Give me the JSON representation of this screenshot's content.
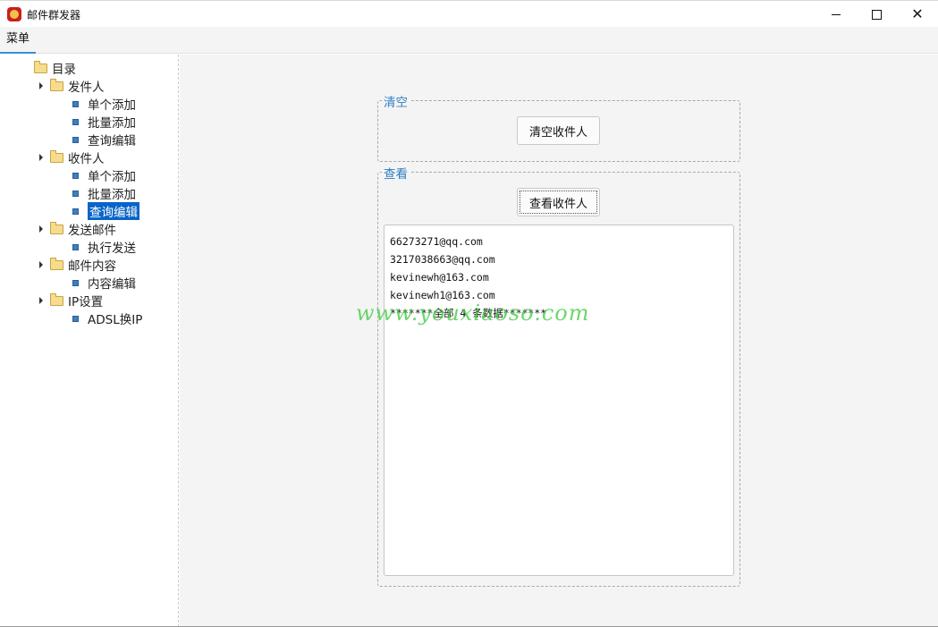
{
  "window": {
    "title": "邮件群发器",
    "controls": {
      "minimize": "minimize-icon",
      "maximize": "maximize-icon",
      "close": "close-icon"
    }
  },
  "menubar": {
    "tab_label": "菜单"
  },
  "tree": {
    "root": "目录",
    "groups": [
      {
        "label": "发件人",
        "children": [
          "单个添加",
          "批量添加",
          "查询编辑"
        ]
      },
      {
        "label": "收件人",
        "children": [
          "单个添加",
          "批量添加",
          "查询编辑"
        ]
      },
      {
        "label": "发送邮件",
        "children": [
          "执行发送"
        ]
      },
      {
        "label": "邮件内容",
        "children": [
          "内容编辑"
        ]
      },
      {
        "label": "IP设置",
        "children": [
          "ADSL换IP"
        ]
      }
    ],
    "selected": "收件人/查询编辑"
  },
  "clear_group": {
    "title": "清空",
    "button": "清空收件人"
  },
  "view_group": {
    "title": "查看",
    "button": "查看收件人",
    "results": [
      "66273271@qq.com",
      "3217038663@qq.com",
      "kevinewh@163.com",
      "kevinewh1@163.com",
      "*******全部 4 条数据*******"
    ]
  },
  "watermark": "www.youxiaoso.com",
  "colors": {
    "accent": "#2f7fc4",
    "selection": "#0a64c8",
    "panel_bg": "#f4f4f4"
  }
}
